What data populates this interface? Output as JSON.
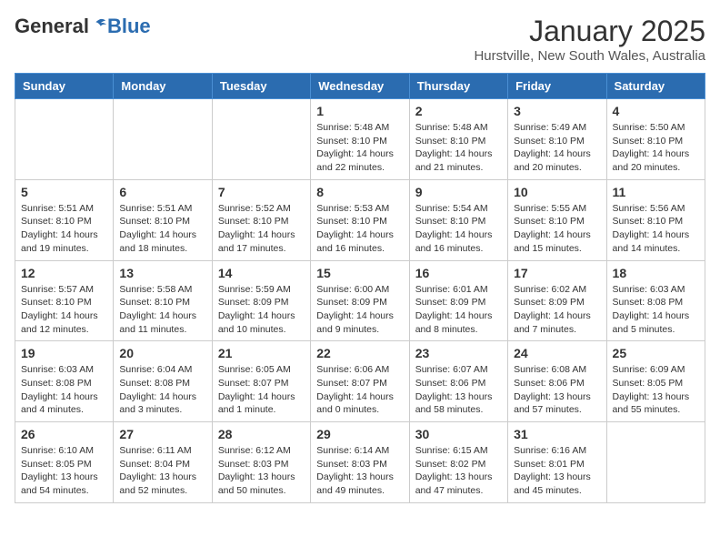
{
  "logo": {
    "general": "General",
    "blue": "Blue"
  },
  "title": "January 2025",
  "location": "Hurstville, New South Wales, Australia",
  "days_of_week": [
    "Sunday",
    "Monday",
    "Tuesday",
    "Wednesday",
    "Thursday",
    "Friday",
    "Saturday"
  ],
  "weeks": [
    [
      {
        "day": "",
        "info": ""
      },
      {
        "day": "",
        "info": ""
      },
      {
        "day": "",
        "info": ""
      },
      {
        "day": "1",
        "info": "Sunrise: 5:48 AM\nSunset: 8:10 PM\nDaylight: 14 hours\nand 22 minutes."
      },
      {
        "day": "2",
        "info": "Sunrise: 5:48 AM\nSunset: 8:10 PM\nDaylight: 14 hours\nand 21 minutes."
      },
      {
        "day": "3",
        "info": "Sunrise: 5:49 AM\nSunset: 8:10 PM\nDaylight: 14 hours\nand 20 minutes."
      },
      {
        "day": "4",
        "info": "Sunrise: 5:50 AM\nSunset: 8:10 PM\nDaylight: 14 hours\nand 20 minutes."
      }
    ],
    [
      {
        "day": "5",
        "info": "Sunrise: 5:51 AM\nSunset: 8:10 PM\nDaylight: 14 hours\nand 19 minutes."
      },
      {
        "day": "6",
        "info": "Sunrise: 5:51 AM\nSunset: 8:10 PM\nDaylight: 14 hours\nand 18 minutes."
      },
      {
        "day": "7",
        "info": "Sunrise: 5:52 AM\nSunset: 8:10 PM\nDaylight: 14 hours\nand 17 minutes."
      },
      {
        "day": "8",
        "info": "Sunrise: 5:53 AM\nSunset: 8:10 PM\nDaylight: 14 hours\nand 16 minutes."
      },
      {
        "day": "9",
        "info": "Sunrise: 5:54 AM\nSunset: 8:10 PM\nDaylight: 14 hours\nand 16 minutes."
      },
      {
        "day": "10",
        "info": "Sunrise: 5:55 AM\nSunset: 8:10 PM\nDaylight: 14 hours\nand 15 minutes."
      },
      {
        "day": "11",
        "info": "Sunrise: 5:56 AM\nSunset: 8:10 PM\nDaylight: 14 hours\nand 14 minutes."
      }
    ],
    [
      {
        "day": "12",
        "info": "Sunrise: 5:57 AM\nSunset: 8:10 PM\nDaylight: 14 hours\nand 12 minutes."
      },
      {
        "day": "13",
        "info": "Sunrise: 5:58 AM\nSunset: 8:10 PM\nDaylight: 14 hours\nand 11 minutes."
      },
      {
        "day": "14",
        "info": "Sunrise: 5:59 AM\nSunset: 8:09 PM\nDaylight: 14 hours\nand 10 minutes."
      },
      {
        "day": "15",
        "info": "Sunrise: 6:00 AM\nSunset: 8:09 PM\nDaylight: 14 hours\nand 9 minutes."
      },
      {
        "day": "16",
        "info": "Sunrise: 6:01 AM\nSunset: 8:09 PM\nDaylight: 14 hours\nand 8 minutes."
      },
      {
        "day": "17",
        "info": "Sunrise: 6:02 AM\nSunset: 8:09 PM\nDaylight: 14 hours\nand 7 minutes."
      },
      {
        "day": "18",
        "info": "Sunrise: 6:03 AM\nSunset: 8:08 PM\nDaylight: 14 hours\nand 5 minutes."
      }
    ],
    [
      {
        "day": "19",
        "info": "Sunrise: 6:03 AM\nSunset: 8:08 PM\nDaylight: 14 hours\nand 4 minutes."
      },
      {
        "day": "20",
        "info": "Sunrise: 6:04 AM\nSunset: 8:08 PM\nDaylight: 14 hours\nand 3 minutes."
      },
      {
        "day": "21",
        "info": "Sunrise: 6:05 AM\nSunset: 8:07 PM\nDaylight: 14 hours\nand 1 minute."
      },
      {
        "day": "22",
        "info": "Sunrise: 6:06 AM\nSunset: 8:07 PM\nDaylight: 14 hours\nand 0 minutes."
      },
      {
        "day": "23",
        "info": "Sunrise: 6:07 AM\nSunset: 8:06 PM\nDaylight: 13 hours\nand 58 minutes."
      },
      {
        "day": "24",
        "info": "Sunrise: 6:08 AM\nSunset: 8:06 PM\nDaylight: 13 hours\nand 57 minutes."
      },
      {
        "day": "25",
        "info": "Sunrise: 6:09 AM\nSunset: 8:05 PM\nDaylight: 13 hours\nand 55 minutes."
      }
    ],
    [
      {
        "day": "26",
        "info": "Sunrise: 6:10 AM\nSunset: 8:05 PM\nDaylight: 13 hours\nand 54 minutes."
      },
      {
        "day": "27",
        "info": "Sunrise: 6:11 AM\nSunset: 8:04 PM\nDaylight: 13 hours\nand 52 minutes."
      },
      {
        "day": "28",
        "info": "Sunrise: 6:12 AM\nSunset: 8:03 PM\nDaylight: 13 hours\nand 50 minutes."
      },
      {
        "day": "29",
        "info": "Sunrise: 6:14 AM\nSunset: 8:03 PM\nDaylight: 13 hours\nand 49 minutes."
      },
      {
        "day": "30",
        "info": "Sunrise: 6:15 AM\nSunset: 8:02 PM\nDaylight: 13 hours\nand 47 minutes."
      },
      {
        "day": "31",
        "info": "Sunrise: 6:16 AM\nSunset: 8:01 PM\nDaylight: 13 hours\nand 45 minutes."
      },
      {
        "day": "",
        "info": ""
      }
    ]
  ]
}
